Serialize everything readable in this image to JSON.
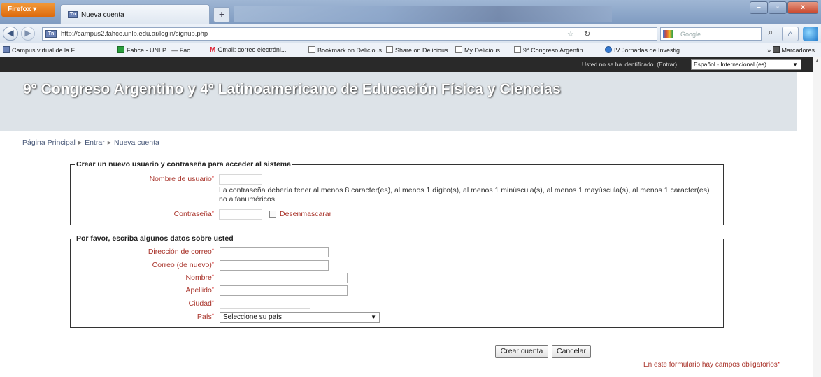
{
  "browser": {
    "menu_button": "Firefox ▾",
    "tab_title": "Nueva cuenta",
    "tab_favicon": "Tn",
    "new_tab": "+",
    "url": "http://campus2.fahce.unlp.edu.ar/login/signup.php",
    "search_placeholder": "Google",
    "window_controls": {
      "minimize": "–",
      "maximize": "▫",
      "close": "x"
    },
    "bookmarks": [
      {
        "label": "Campus virtual de la F...",
        "icon": "campus-icon"
      },
      {
        "label": "Fahce - UNLP | — Fac...",
        "icon": "fahce-icon"
      },
      {
        "label": "Gmail: correo electróni...",
        "icon": "gmail-icon"
      },
      {
        "label": "Bookmark on Delicious",
        "icon": "delicious-icon"
      },
      {
        "label": "Share on Delicious",
        "icon": "delicious-icon"
      },
      {
        "label": "My Delicious",
        "icon": "delicious-icon"
      },
      {
        "label": "9° Congreso Argentin...",
        "icon": "page-icon"
      },
      {
        "label": "IV Jornadas de Investig...",
        "icon": "globe-icon"
      }
    ],
    "bookmarks_overflow": "» ",
    "other_bookmarks": "Marcadores"
  },
  "usermenu": {
    "login_info": "Usted no se ha identificado. (Entrar)",
    "language": "Español - Internacional (es)"
  },
  "header": {
    "site_title": "9º Congreso Argentino y 4º Latinoamericano de Educación Física y Ciencias"
  },
  "breadcrumb": [
    "Página Principal",
    "Entrar",
    "Nueva cuenta"
  ],
  "breadcrumb_separator": "▸",
  "form": {
    "section1": {
      "legend": "Crear un nuevo usuario y contraseña para acceder al sistema",
      "username_label": "Nombre de usuario",
      "password_hint": "La contraseña debería tener al menos 8 caracter(es), al menos 1 dígito(s), al menos 1 minúscula(s), al menos 1 mayúscula(s), al menos 1 caracter(es) no alfanuméricos",
      "password_label": "Contraseña",
      "unmask_label": "Desenmascarar"
    },
    "section2": {
      "legend": "Por favor, escriba algunos datos sobre usted",
      "email_label": "Dirección de correo",
      "email2_label": "Correo (de nuevo)",
      "firstname_label": "Nombre",
      "lastname_label": "Apellido",
      "city_label": "Ciudad",
      "country_label": "País",
      "country_value": "Seleccione su país"
    },
    "required_marker": "*",
    "create_button": "Crear cuenta",
    "cancel_button": "Cancelar",
    "required_note": "En este formulario hay campos obligatorios"
  }
}
